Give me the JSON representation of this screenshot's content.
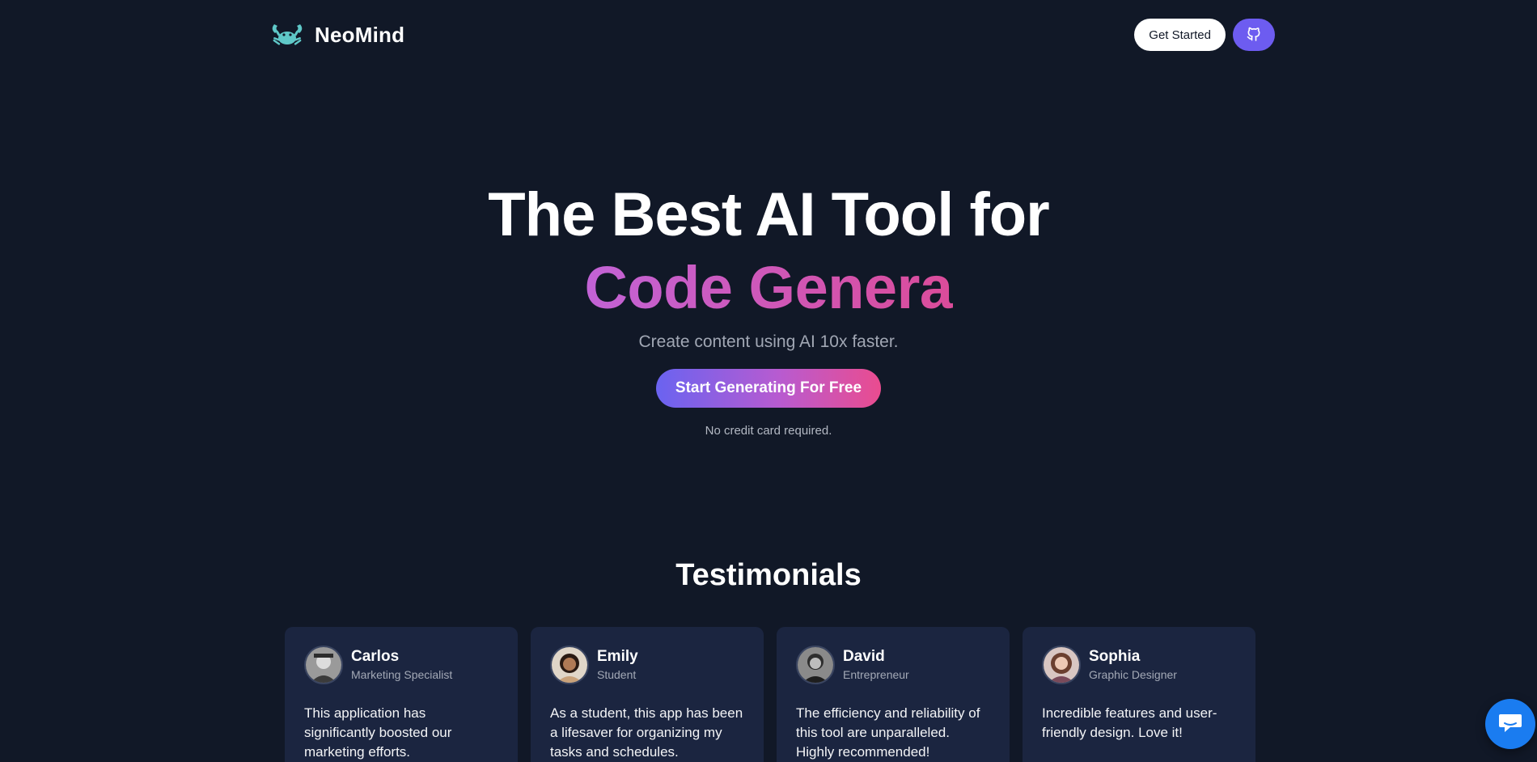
{
  "brand": {
    "name": "NeoMind",
    "logo_icon": "crab-icon",
    "logo_color": "#5fc8c8"
  },
  "nav": {
    "get_started_label": "Get Started",
    "github_icon": "github-icon",
    "github_button_color": "#6d5cf0"
  },
  "hero": {
    "title_line1": "The Best AI Tool for",
    "typed_text": "Code Genera",
    "subtitle": "Create content using AI 10x faster.",
    "cta_label": "Start Generating For Free",
    "note": "No credit card required."
  },
  "testimonials": {
    "title": "Testimonials",
    "items": [
      {
        "name": "Carlos",
        "role": "Marketing Specialist",
        "text": "This application has significantly boosted our marketing efforts."
      },
      {
        "name": "Emily",
        "role": "Student",
        "text": "As a student, this app has been a lifesaver for organizing my tasks and schedules."
      },
      {
        "name": "David",
        "role": "Entrepreneur",
        "text": "The efficiency and reliability of this tool are unparalleled. Highly recommended!"
      },
      {
        "name": "Sophia",
        "role": "Graphic Designer",
        "text": "Incredible features and user-friendly design. Love it!"
      }
    ]
  },
  "chat_widget": {
    "icon": "chat-bubble-icon",
    "color": "#1a7cf0"
  },
  "colors": {
    "background": "#111827",
    "card": "#1b2540",
    "gradient_start": "#6a63f0",
    "gradient_end": "#ea4c8f"
  }
}
